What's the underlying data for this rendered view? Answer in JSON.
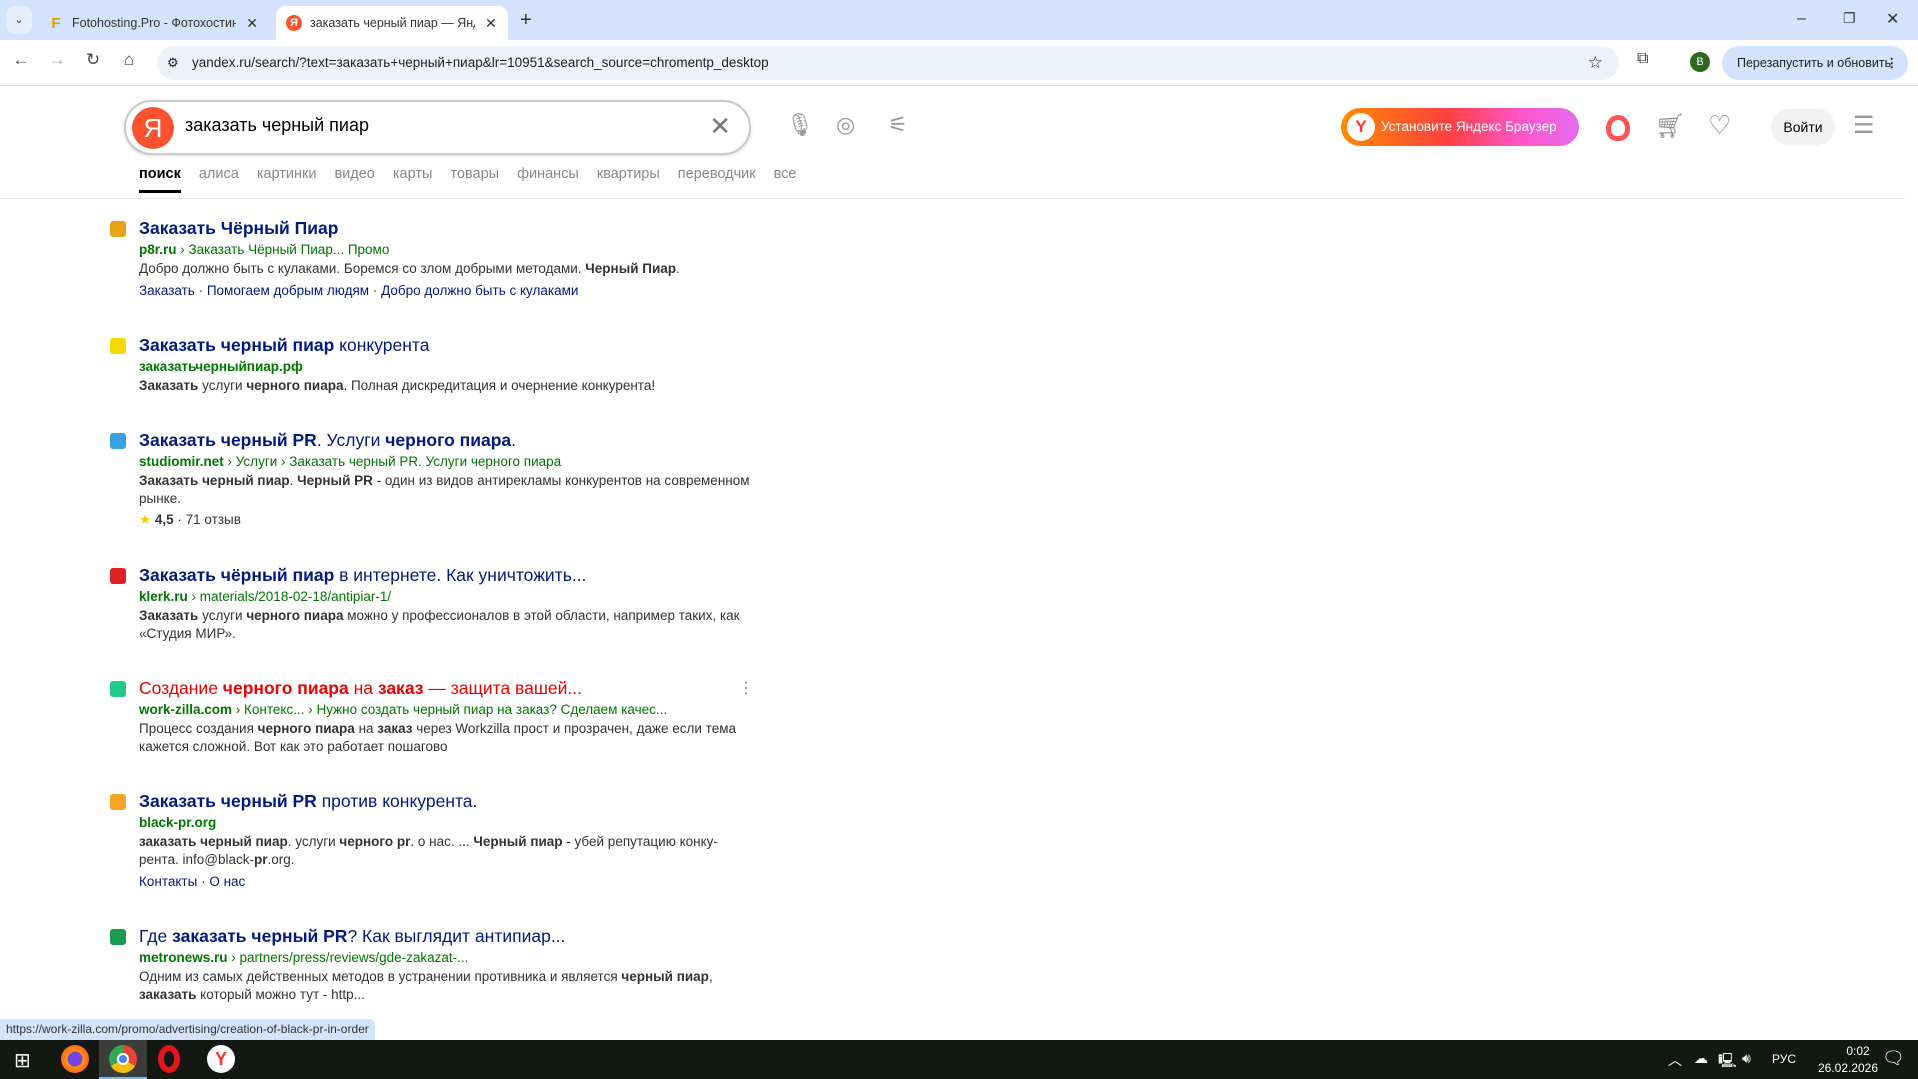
{
  "browser": {
    "tabs": [
      {
        "title": "Fotohosting.Pro - Фотохостинг",
        "favicon": "F"
      },
      {
        "title": "заказать черный пиар — Яндекс",
        "favicon": "Я"
      }
    ],
    "new_tab": "+",
    "url": "yandex.ru/search/?text=заказать+черный+пиар&lr=10951&search_source=chromentp_desktop",
    "profile": "B",
    "restart_label": "Перезапустить и обновить",
    "status_url": "https://work-zilla.com/promo/advertising/creation-of-black-pr-in-order"
  },
  "header": {
    "logo": "Я",
    "query": "заказать черный пиар",
    "install_label": "Установите Яндекс Браузер",
    "login_label": "Войти",
    "tabs": [
      "поиск",
      "алиса",
      "картинки",
      "видео",
      "карты",
      "товары",
      "финансы",
      "квартиры",
      "переводчик",
      "все"
    ]
  },
  "results": [
    {
      "icon_color": "#e8a317",
      "title": [
        {
          "t": "Заказать Чёрный Пиар",
          "b": 1
        }
      ],
      "url": [
        {
          "t": "p8r.ru",
          "b": 1
        },
        {
          "t": " › Заказать Чёрный Пиар...  Промо"
        }
      ],
      "text": [
        {
          "t": "Добро должно быть с кулаками. Боремся со злом добрыми методами. "
        },
        {
          "t": "Черный Пиар",
          "b": 1
        },
        {
          "t": "."
        }
      ],
      "links": [
        "Заказать",
        "Помогаем добрым людям",
        "Добро должно быть с кулаками"
      ]
    },
    {
      "icon_color": "#f5d800",
      "title": [
        {
          "t": "Заказать черный пиар",
          "b": 1
        },
        {
          "t": " конкурента"
        }
      ],
      "url": [
        {
          "t": "заказатьчерныйпиар.рф",
          "b": 1
        }
      ],
      "text": [
        {
          "t": "Заказать",
          "b": 1
        },
        {
          "t": " услуги "
        },
        {
          "t": "черного пиара",
          "b": 1
        },
        {
          "t": ". Полная дискредитация и очернение конкурента!"
        }
      ]
    },
    {
      "icon_color": "#3aa0e0",
      "title": [
        {
          "t": "Заказать черный PR",
          "b": 1
        },
        {
          "t": ". Услуги "
        },
        {
          "t": "черного пиара",
          "b": 1
        },
        {
          "t": "."
        }
      ],
      "url": [
        {
          "t": "studiomir.net",
          "b": 1
        },
        {
          "t": " › Услуги › Заказать черный PR. Услуги черного пиара"
        }
      ],
      "text": [
        {
          "t": "Заказать черный пиар",
          "b": 1
        },
        {
          "t": ". "
        },
        {
          "t": "Черный PR",
          "b": 1
        },
        {
          "t": " - один из видов антирекламы конкурентов на совре­менном рынке."
        }
      ],
      "rating": "4,5",
      "reviews": "· 71 отзыв"
    },
    {
      "icon_color": "#e02020",
      "title": [
        {
          "t": "Заказать чёрный пиар",
          "b": 1
        },
        {
          "t": " в интернете. Как уничтожить..."
        }
      ],
      "url": [
        {
          "t": "klerk.ru",
          "b": 1
        },
        {
          "t": " › materials/2018-02-18/antipiar-1/"
        }
      ],
      "text": [
        {
          "t": "Заказать",
          "b": 1
        },
        {
          "t": " услуги "
        },
        {
          "t": "черного пиара",
          "b": 1
        },
        {
          "t": " можно у профессионалов в этой области, например таких, как «Студия МИР»."
        }
      ]
    },
    {
      "icon_color": "#1fc98a",
      "ad": true,
      "title": [
        {
          "t": "Создание "
        },
        {
          "t": "черного пиара",
          "b": 1
        },
        {
          "t": " на "
        },
        {
          "t": "заказ",
          "b": 1
        },
        {
          "t": " — защита вашей..."
        }
      ],
      "url": [
        {
          "t": "work-zilla.com",
          "b": 1
        },
        {
          "t": " › Контекс... › Нужно создать черный пиар на заказ? Сделаем качес..."
        }
      ],
      "text": [
        {
          "t": "Процесс создания "
        },
        {
          "t": "черного пиара",
          "b": 1
        },
        {
          "t": " на "
        },
        {
          "t": "заказ",
          "b": 1
        },
        {
          "t": " через Workzilla прост и прозрачен, даже если тема кажется сложной. Вот как это работает пошагово"
        }
      ]
    },
    {
      "icon_color": "#f5a623",
      "title": [
        {
          "t": "Заказать черный PR",
          "b": 1
        },
        {
          "t": " против конкурента."
        }
      ],
      "url": [
        {
          "t": "black-pr.org",
          "b": 1
        }
      ],
      "text": [
        {
          "t": "заказать черный пиар",
          "b": 1
        },
        {
          "t": ". услуги "
        },
        {
          "t": "черного pr",
          "b": 1
        },
        {
          "t": ". о нас. ... "
        },
        {
          "t": "Черный пиар",
          "b": 1
        },
        {
          "t": " - убей репутацию конку­рента. info@black-"
        },
        {
          "t": "pr",
          "b": 1
        },
        {
          "t": ".org."
        }
      ],
      "links": [
        "Контакты",
        "О нас"
      ]
    },
    {
      "icon_color": "#1a9c4c",
      "title": [
        {
          "t": "Где "
        },
        {
          "t": "заказать черный PR",
          "b": 1
        },
        {
          "t": "? Как выглядит антипиар..."
        }
      ],
      "url": [
        {
          "t": "metronews.ru",
          "b": 1
        },
        {
          "t": " › partners/press/reviews/gde-zakazat-..."
        }
      ],
      "text": [
        {
          "t": "Одним из самых действенных методов в устранении противника и является "
        },
        {
          "t": "черный пиар",
          "b": 1
        },
        {
          "t": ", "
        },
        {
          "t": "заказать",
          "b": 1
        },
        {
          "t": " который можно тут - http..."
        }
      ]
    }
  ],
  "taskbar": {
    "lang": "РУС",
    "time": "0:02",
    "date": "26.02.2026"
  }
}
